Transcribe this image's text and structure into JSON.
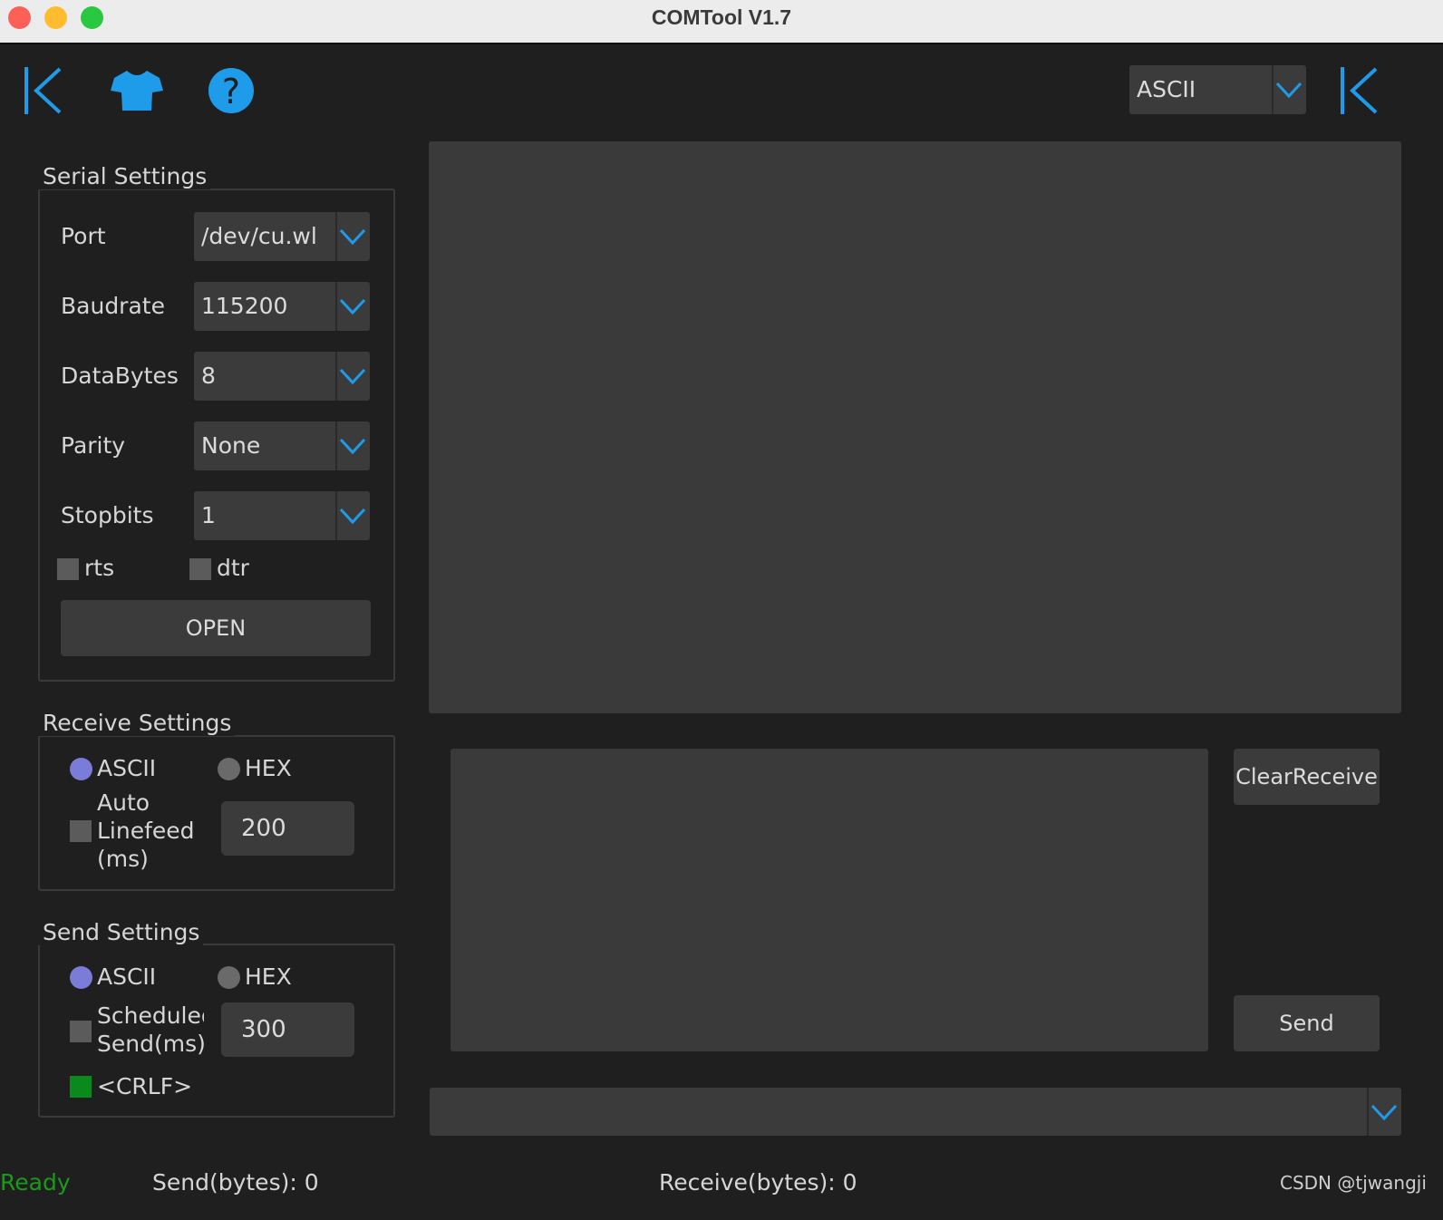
{
  "window": {
    "title": "COMTool V1.7"
  },
  "toolbar": {
    "left_icons": [
      "collapse-left-icon",
      "skin-shirt-icon",
      "help-icon"
    ],
    "encoding_value": "ASCII",
    "accent": "#1e9be9"
  },
  "serial_settings": {
    "title": "Serial Settings",
    "port": {
      "label": "Port",
      "value": "/dev/cu.wl"
    },
    "baudrate": {
      "label": "Baudrate",
      "value": "115200"
    },
    "databytes": {
      "label": "DataBytes",
      "value": "8"
    },
    "parity": {
      "label": "Parity",
      "value": "None"
    },
    "stopbits": {
      "label": "Stopbits",
      "value": "1"
    },
    "rts_label": "rts",
    "dtr_label": "dtr",
    "open_label": "OPEN"
  },
  "receive_settings": {
    "title": "Receive Settings",
    "ascii_label": "ASCII",
    "hex_label": "HEX",
    "auto_linefeed_line1": "Auto",
    "auto_linefeed_line2": "Linefeed",
    "auto_linefeed_line3": "(ms)",
    "auto_linefeed_value": "200"
  },
  "send_settings": {
    "title": "Send Settings",
    "ascii_label": "ASCII",
    "hex_label": "HEX",
    "scheduled_line1": "Scheduled",
    "scheduled_line2": "Send(ms)",
    "scheduled_value": "300",
    "crlf_label": "<CRLF>",
    "crlf_color": "#0a8a1c"
  },
  "main": {
    "clear_receive_label": "ClearReceive",
    "send_label": "Send"
  },
  "status": {
    "ready": "Ready",
    "ready_color": "#1a9a1a",
    "send_bytes": "Send(bytes): 0",
    "receive_bytes": "Receive(bytes): 0",
    "watermark": "CSDN @tjwangji"
  },
  "colors": {
    "radio_selected": "#7b7bd8",
    "radio_unselected": "#6a6a6a"
  }
}
